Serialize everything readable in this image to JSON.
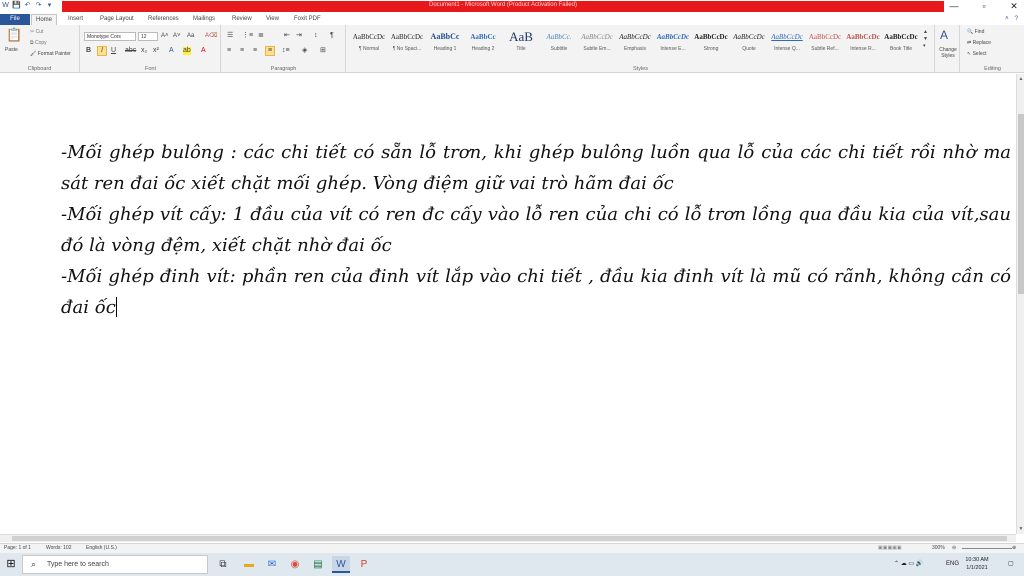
{
  "window": {
    "title": "Document1 - Microsoft Word (Product Activation Failed)",
    "controls": [
      "—",
      "▫",
      "✕"
    ]
  },
  "qat": [
    "W",
    "💾",
    "↶",
    "↷",
    "▾"
  ],
  "tabs": [
    "File",
    "Home",
    "Insert",
    "Page Layout",
    "References",
    "Mailings",
    "Review",
    "View",
    "Foxit PDF"
  ],
  "ribbon_controls": [
    "˄",
    "?"
  ],
  "clipboard": {
    "paste": "Paste",
    "cut": "Cut",
    "copy": "Copy",
    "format_painter": "Format Painter",
    "label": "Clipboard"
  },
  "font": {
    "name": "Monotype Cors",
    "size": "12",
    "label": "Font"
  },
  "paragraph": {
    "label": "Paragraph"
  },
  "styles": {
    "label": "Styles",
    "items": [
      {
        "preview": "AaBbCcDc",
        "name": "¶ Normal"
      },
      {
        "preview": "AaBbCcDc",
        "name": "¶ No Spaci..."
      },
      {
        "preview": "AaBbCc",
        "name": "Heading 1"
      },
      {
        "preview": "AaBbCc",
        "name": "Heading 2"
      },
      {
        "preview": "AaB",
        "name": "Title"
      },
      {
        "preview": "AaBbCc.",
        "name": "Subtitle"
      },
      {
        "preview": "AaBbCcDc",
        "name": "Subtle Em..."
      },
      {
        "preview": "AaBbCcDc",
        "name": "Emphasis"
      },
      {
        "preview": "AaBbCcDc",
        "name": "Intense E..."
      },
      {
        "preview": "AaBbCcDc",
        "name": "Strong"
      },
      {
        "preview": "AaBbCcDc",
        "name": "Quote"
      },
      {
        "preview": "AaBbCcDc",
        "name": "Intense Q..."
      },
      {
        "preview": "AaBbCcDc",
        "name": "Subtle Ref..."
      },
      {
        "preview": "AaBbCcDc",
        "name": "Intense R..."
      },
      {
        "preview": "AaBbCcDc",
        "name": "Book Title"
      }
    ],
    "change_styles": "Change Styles"
  },
  "editing": {
    "find": "Find",
    "replace": "Replace",
    "select": "Select",
    "label": "Editing"
  },
  "document": {
    "paragraphs": [
      "-Mối ghép bulông : các chi tiết có sẵn lỗ trơn, khi ghép bulông luồn qua lỗ của các chi tiết rồi nhờ ma sát ren đai ốc xiết chặt mối ghép. Vòng điệm giữ vai trò hãm đai ốc",
      "-Mối ghép vít cấy: 1 đầu của vít có ren đc cấy vào lỗ ren của chi có lỗ trơn lồng qua đầu kia của vít,sau đó là vòng đệm, xiết chặt nhờ đai ốc",
      "-Mối ghép đinh vít: phần ren của đinh vít lắp vào chi tiết , đầu kia đinh vít là mũ có rãnh, không cần có đai ốc"
    ]
  },
  "status": {
    "page": "Page: 1 of 1",
    "words": "Words: 102",
    "language": "English (U.S.)",
    "zoom": "300%"
  },
  "taskbar": {
    "search_placeholder": "Type here to search",
    "lang": "ENG",
    "time": "10:30 AM",
    "date": "1/1/2021"
  }
}
